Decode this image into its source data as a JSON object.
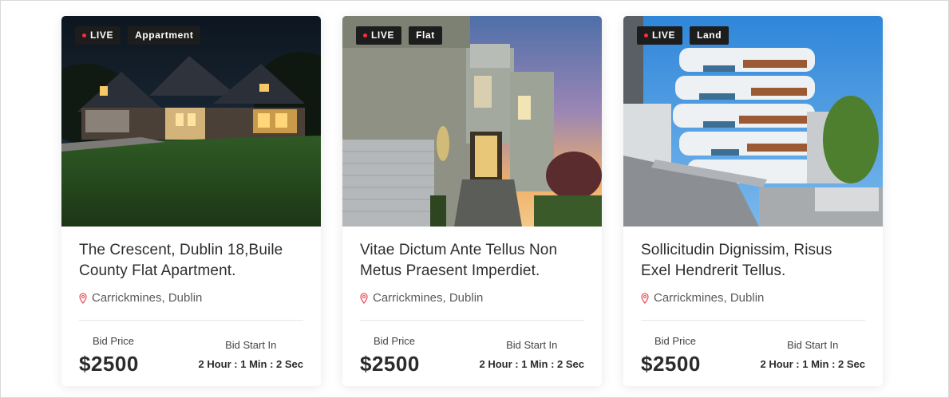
{
  "cards": [
    {
      "live_label": "LIVE",
      "category": "Appartment",
      "title_line1": "The Crescent, Dublin 18,Buile",
      "title_line2": "County Flat Apartment.",
      "location": "Carrickmines, Dublin",
      "bid_label": "Bid Price",
      "bid_price": "$2500",
      "start_label": "Bid Start In",
      "start_time": "2 Hour : 1 Min : 2 Sec"
    },
    {
      "live_label": "LIVE",
      "category": "Flat",
      "title_line1": "Vitae Dictum Ante Tellus Non",
      "title_line2": "Metus Praesent Imperdiet.",
      "location": "Carrickmines, Dublin",
      "bid_label": "Bid Price",
      "bid_price": "$2500",
      "start_label": "Bid Start In",
      "start_time": "2 Hour : 1 Min : 2 Sec"
    },
    {
      "live_label": "LIVE",
      "category": "Land",
      "title_line1": "Sollicitudin Dignissim, Risus",
      "title_line2": "Exel Hendrerit Tellus.",
      "location": "Carrickmines, Dublin",
      "bid_label": "Bid Price",
      "bid_price": "$2500",
      "start_label": "Bid Start In",
      "start_time": "2 Hour : 1 Min : 2 Sec"
    }
  ],
  "icons": {
    "location": "map-pin-icon",
    "live": "live-dot-icon"
  },
  "colors": {
    "live_dot": "#ff2b3b",
    "pin": "#e8505b",
    "badge_bg": "#1d1d1d"
  }
}
